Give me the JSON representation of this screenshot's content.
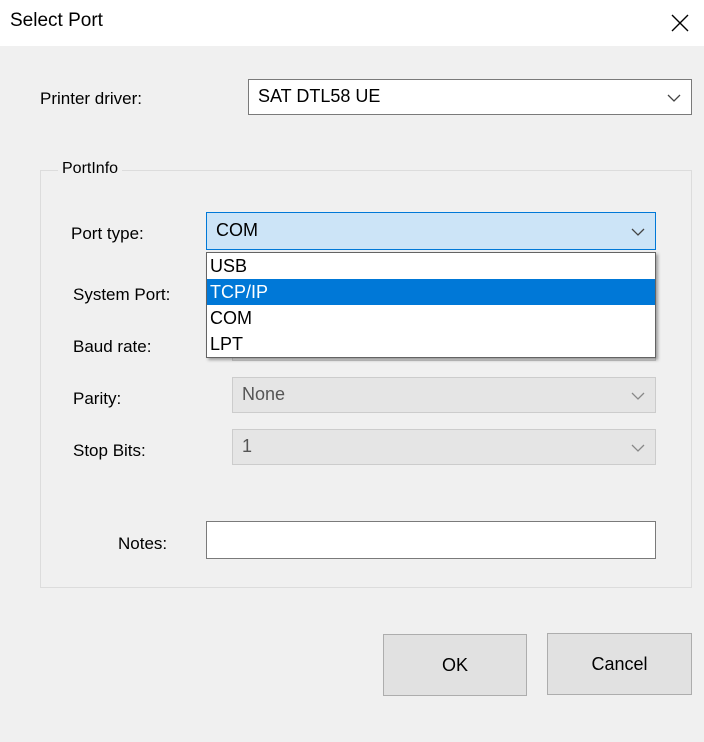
{
  "window": {
    "title": "Select Port"
  },
  "printer_driver": {
    "label": "Printer driver:",
    "value": "SAT DTL58 UE"
  },
  "port_info": {
    "group_label": "PortInfo",
    "port_type": {
      "label": "Port type:",
      "value": "COM",
      "options": [
        "USB",
        "TCP/IP",
        "COM",
        "LPT"
      ],
      "highlighted": "TCP/IP"
    },
    "system_port": {
      "label": "System Port:"
    },
    "baud_rate": {
      "label": "Baud rate:"
    },
    "parity": {
      "label": "Parity:",
      "value": "None"
    },
    "stop_bits": {
      "label": "Stop Bits:",
      "value": "1"
    },
    "notes": {
      "label": "Notes:",
      "value": ""
    }
  },
  "buttons": {
    "ok": "OK",
    "cancel": "Cancel"
  },
  "colors": {
    "accent": "#0078d7",
    "active_field": "#cce4f7",
    "dialog_bg": "#f0f0f0"
  }
}
